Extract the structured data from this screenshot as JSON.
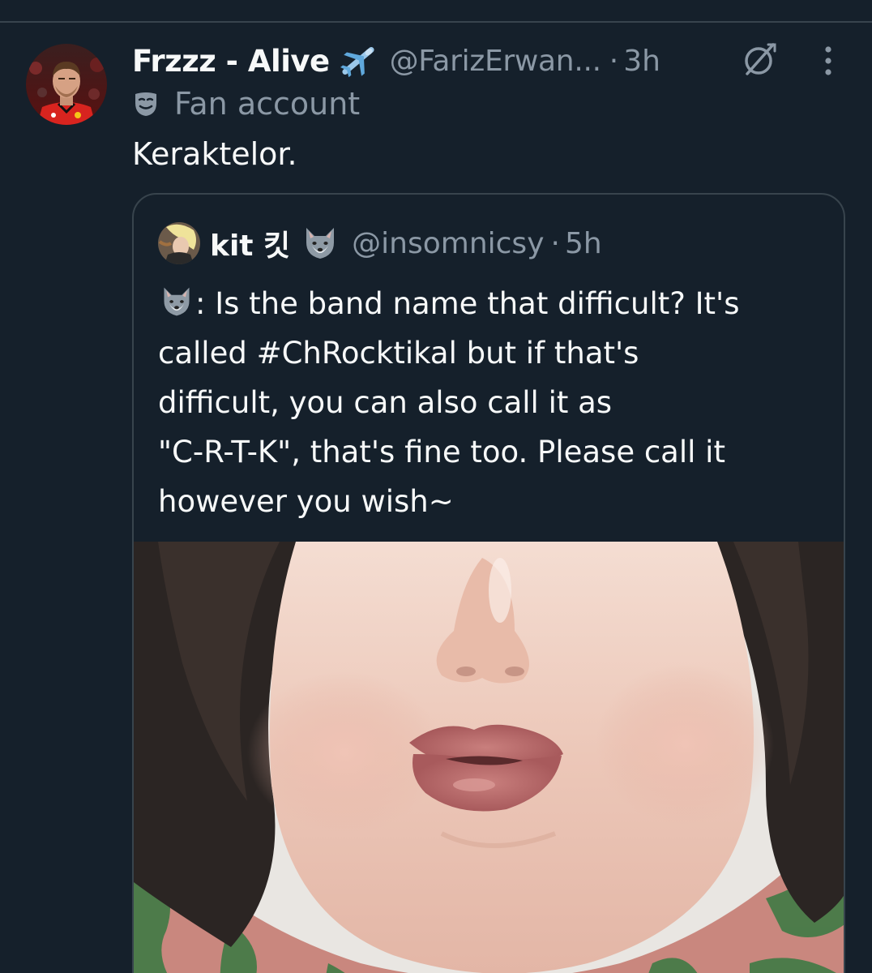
{
  "tweet": {
    "display_name": "Frzzz - Alive",
    "handle": "@FarizErwan...",
    "separator": "·",
    "time": "3h",
    "label": "Fan account",
    "text": "Keraktelor."
  },
  "quote": {
    "display_name": "kit 킷",
    "handle": "@insomnicsy",
    "separator": "·",
    "time": "5h",
    "lines": [
      ": Is the band name that difficult? It's",
      "called #ChRocktikal but if that's",
      "difficult, you can also call it as",
      "\"C-R-T-K\", that's fine too. Please call it",
      "however you wish~"
    ]
  },
  "colors": {
    "background": "#15202b",
    "text_primary": "#f7f9f9",
    "text_secondary": "#8b98a5",
    "border": "#38444d"
  },
  "icons": {
    "plane": "airplane-emoji-icon",
    "grok": "grok-icon",
    "more": "more-options-icon",
    "fan_label": "theater-mask-icon",
    "wolf": "wolf-emoji-icon"
  }
}
